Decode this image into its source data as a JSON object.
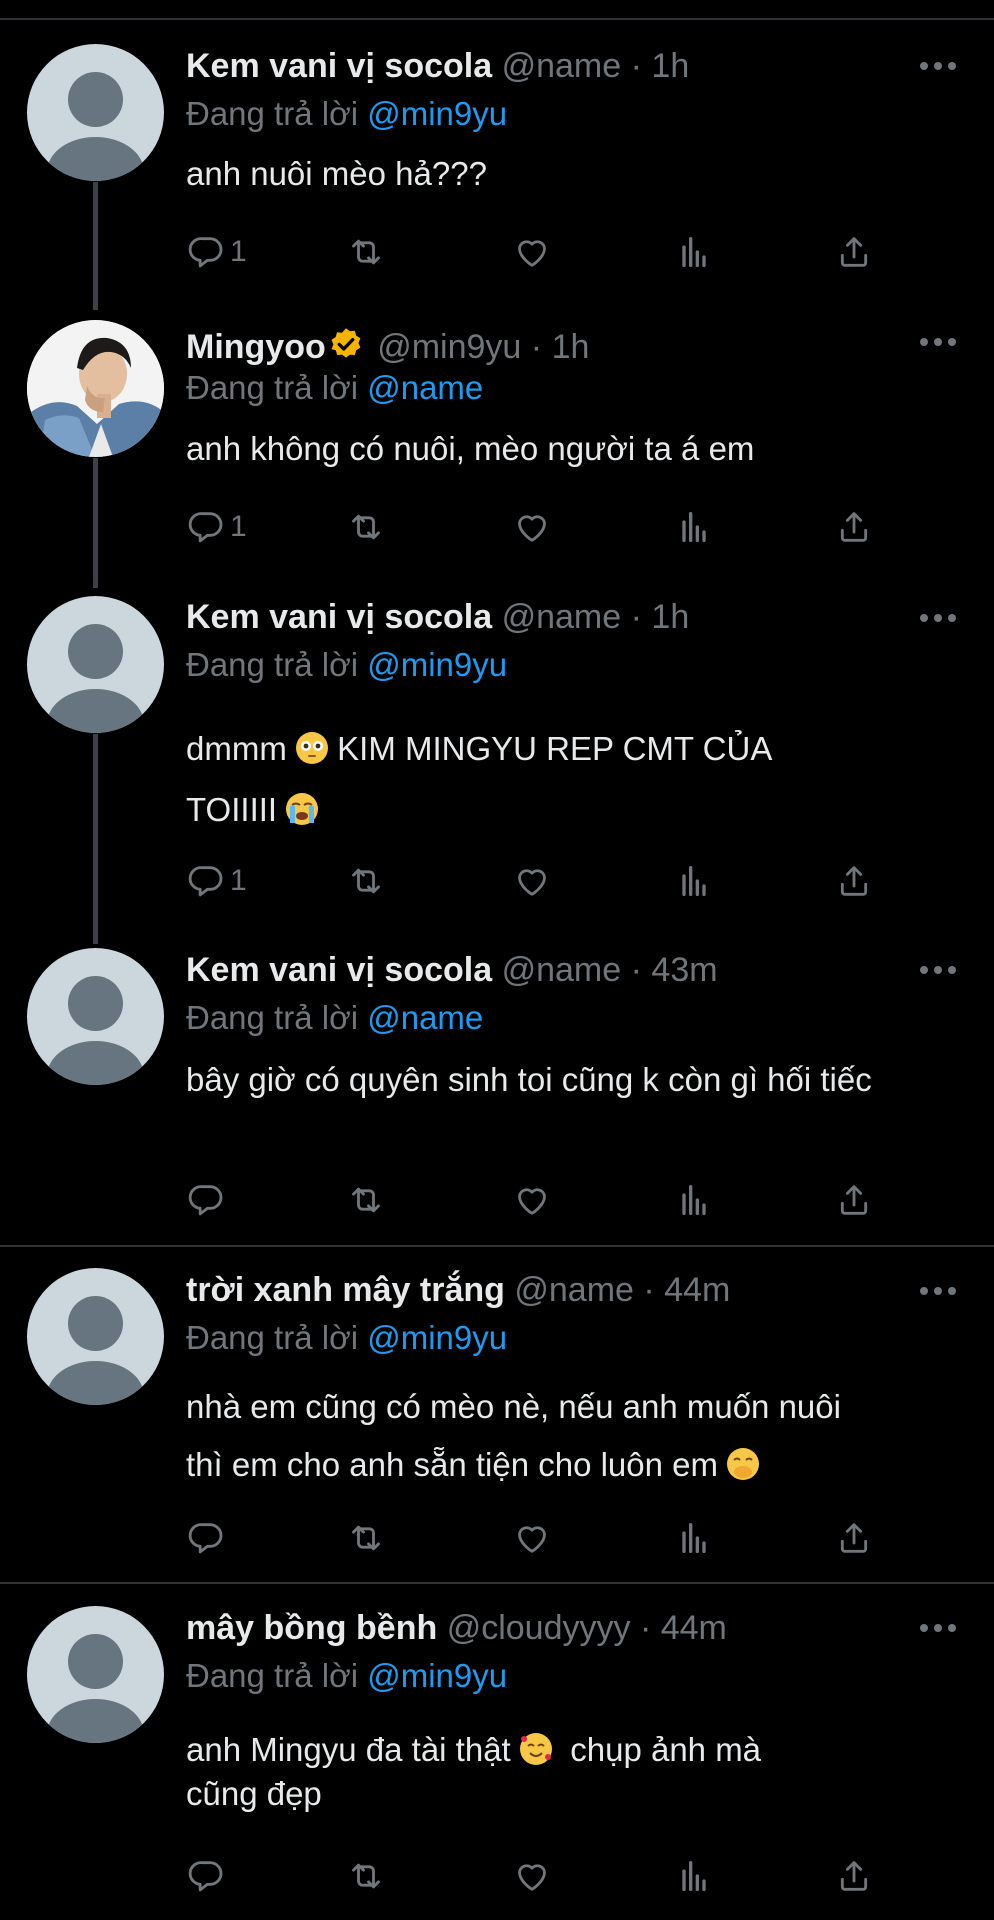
{
  "tweets": [
    {
      "name": "Kem vani vị socola",
      "handle": "@name",
      "dot": "·",
      "time": "1h",
      "reply_prefix": "Đang trả lời",
      "reply_to": "@min9yu",
      "text": "anh nuôi mèo hả???",
      "reply_count": "1"
    },
    {
      "name": "Mingyoo",
      "handle": "@min9yu",
      "dot": "·",
      "time": "1h",
      "reply_prefix": "Đang trả lời",
      "reply_to": "@name",
      "text": "anh không có nuôi, mèo người ta á em",
      "reply_count": "1"
    },
    {
      "name": "Kem vani vị socola",
      "handle": "@name",
      "dot": "·",
      "time": "1h",
      "reply_prefix": "Đang trả lời",
      "reply_to": "@min9yu",
      "text_a": "dmmm",
      "text_b": "KIM MINGYU REP CMT CỦA",
      "text_c": "TOIIIII",
      "reply_count": "1"
    },
    {
      "name": "Kem vani vị socola",
      "handle": "@name",
      "dot": "·",
      "time": "43m",
      "reply_prefix": "Đang trả lời",
      "reply_to": "@name",
      "text": "bây giờ có quyên sinh toi cũng k còn gì hối tiếc",
      "reply_count": ""
    },
    {
      "name": "trời xanh mây trắng",
      "handle": "@name",
      "dot": "·",
      "time": "44m",
      "reply_prefix": "Đang trả lời",
      "reply_to": "@min9yu",
      "text_a": "nhà em cũng có mèo nè, nếu anh muốn nuôi",
      "text_b": "thì em cho anh sẵn tiện cho luôn em",
      "reply_count": ""
    },
    {
      "name": "mây bồng bềnh",
      "handle": "@cloudyyyy",
      "dot": "·",
      "time": "44m",
      "reply_prefix": "Đang trả lời",
      "reply_to": "@min9yu",
      "text_a": "anh Mingyu đa tài thật",
      "text_b": "chụp ảnh mà",
      "text_c": "cũng đẹp",
      "reply_count": ""
    }
  ],
  "icons": [
    "reply-icon",
    "retweet-icon",
    "like-icon",
    "analytics-icon",
    "share-icon",
    "more-icon",
    "verified-badge-icon"
  ],
  "colors": {
    "background": "#000000",
    "text": "#e7e9ea",
    "muted": "#71767b",
    "link": "#1d9bf0",
    "verified": "#f4b400"
  }
}
